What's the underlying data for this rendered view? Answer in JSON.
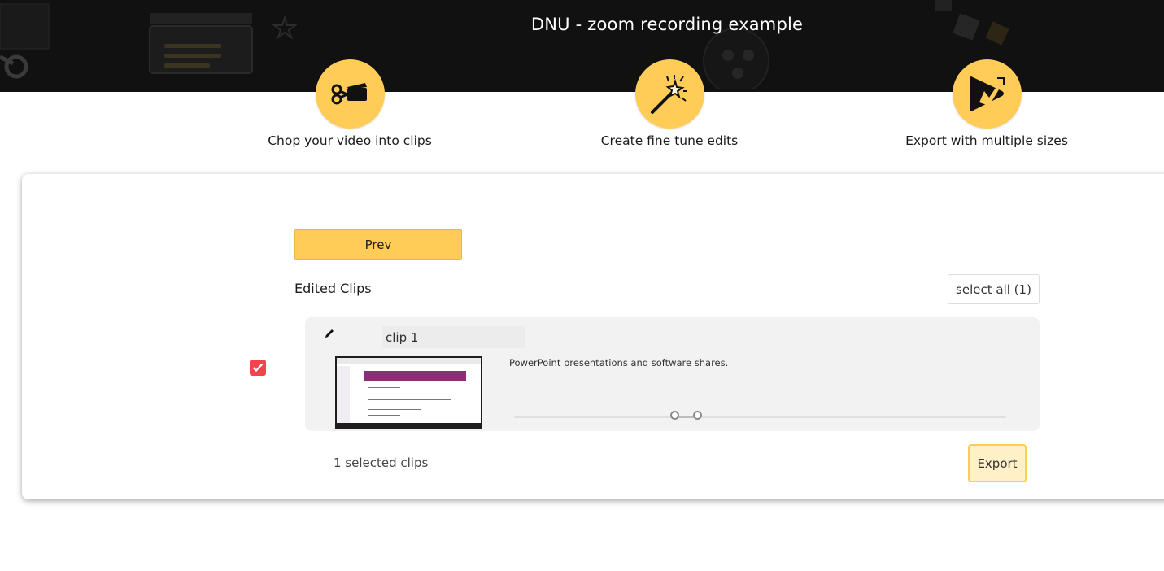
{
  "header": {
    "title": "DNU - zoom recording example"
  },
  "steps": [
    {
      "icon": "scissors-film-icon",
      "label": "Chop your video into clips"
    },
    {
      "icon": "magic-wand-icon",
      "label": "Create fine tune edits"
    },
    {
      "icon": "play-export-icon",
      "label": "Export with multiple sizes"
    }
  ],
  "colors": {
    "accent": "#ffcd57",
    "header_bg": "#111111",
    "checkbox": "#f0454d",
    "clip_bg": "#f2f2f2"
  },
  "card": {
    "prev_label": "Prev",
    "section_title": "Edited Clips",
    "select_all_label": "select all (1)",
    "clip": {
      "checked": true,
      "name": "clip 1",
      "description": "PowerPoint presentations and software shares.",
      "range_start": 0.325,
      "range_end": 0.372
    },
    "selected_count_text": "1 selected clips",
    "export_label": "Export"
  }
}
